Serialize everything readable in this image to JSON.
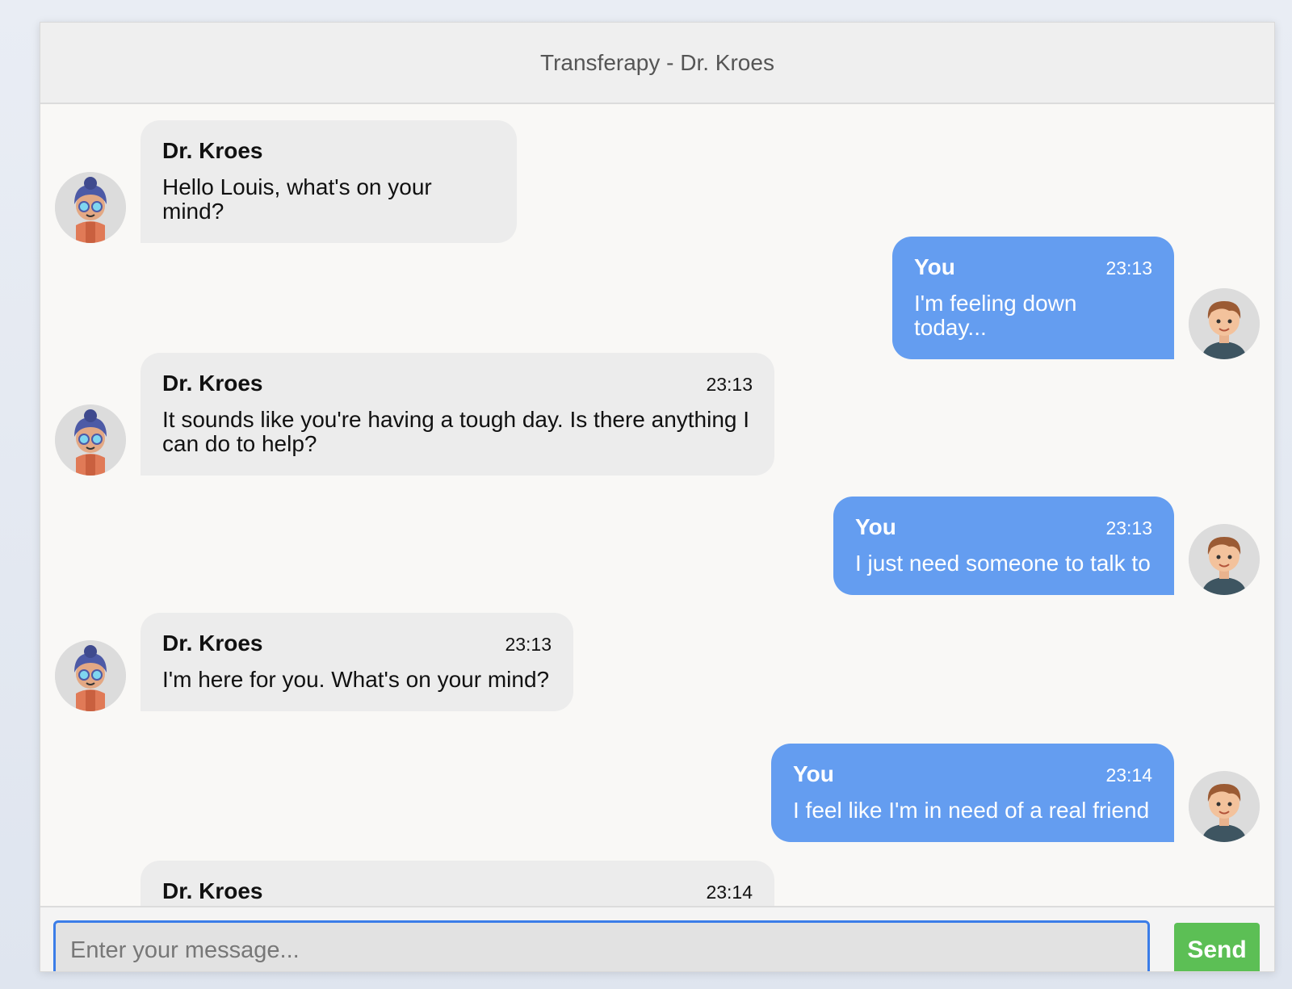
{
  "header": {
    "title": "Transferapy - Dr. Kroes"
  },
  "messages": [
    {
      "role": "therapist",
      "sender": "Dr. Kroes",
      "time": "",
      "text": "Hello Louis, what's on your mind?"
    },
    {
      "role": "user",
      "sender": "You",
      "time": "23:13",
      "text": "I'm feeling down today..."
    },
    {
      "role": "therapist",
      "sender": "Dr. Kroes",
      "time": "23:13",
      "text": "It sounds like you're having a tough day. Is there anything I can do to help?"
    },
    {
      "role": "user",
      "sender": "You",
      "time": "23:13",
      "text": "I just need someone to talk to"
    },
    {
      "role": "therapist",
      "sender": "Dr. Kroes",
      "time": "23:13",
      "text": "I'm here for you. What's on your mind?"
    },
    {
      "role": "user",
      "sender": "You",
      "time": "23:14",
      "text": "I feel like I'm in need of a real friend"
    },
    {
      "role": "therapist",
      "sender": "Dr. Kroes",
      "time": "23:14",
      "text": ""
    }
  ],
  "input": {
    "placeholder": "Enter your message...",
    "value": ""
  },
  "send_button": {
    "label": "Send"
  },
  "colors": {
    "user_bubble": "#649df0",
    "therapist_bubble": "#ececec",
    "send_button": "#5cbf55",
    "input_focus_border": "#3b7de8"
  },
  "icons": {
    "therapist_avatar": "therapist-avatar-icon",
    "user_avatar": "user-avatar-icon"
  }
}
